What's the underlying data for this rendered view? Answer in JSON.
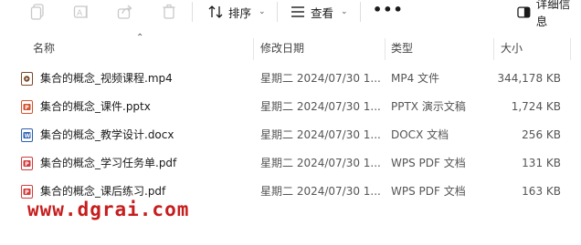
{
  "toolbar": {
    "sort_label": "排序",
    "view_label": "查看",
    "more_label": "•••",
    "details_label": "详细信息",
    "icons": [
      "copy-icon",
      "rename-icon",
      "share-icon",
      "delete-icon",
      "sort-icon",
      "view-icon",
      "details-pane-icon"
    ]
  },
  "columns": {
    "name": "名称",
    "modified": "修改日期",
    "type": "类型",
    "size": "大小"
  },
  "files": [
    {
      "name": "集合的概念_视频课程.mp4",
      "modified": "星期二 2024/07/30 1...",
      "type": "MP4 文件",
      "size": "344,178 KB",
      "icon": "mp4-file-icon",
      "icon_color": "#7a4a2a"
    },
    {
      "name": "集合的概念_课件.pptx",
      "modified": "星期二 2024/07/30 1...",
      "type": "PPTX 演示文稿",
      "size": "1,724 KB",
      "icon": "pptx-file-icon",
      "icon_color": "#d35230"
    },
    {
      "name": "集合的概念_教学设计.docx",
      "modified": "星期二 2024/07/30 1...",
      "type": "DOCX 文档",
      "size": "256 KB",
      "icon": "docx-file-icon",
      "icon_color": "#2b5fb4"
    },
    {
      "name": "集合的概念_学习任务单.pdf",
      "modified": "星期二 2024/07/30 1...",
      "type": "WPS PDF 文档",
      "size": "131 KB",
      "icon": "pdf-file-icon",
      "icon_color": "#d23c3c"
    },
    {
      "name": "集合的概念_课后练习.pdf",
      "modified": "星期二 2024/07/30 1...",
      "type": "WPS PDF 文档",
      "size": "163 KB",
      "icon": "pdf-file-icon",
      "icon_color": "#d23c3c"
    }
  ],
  "watermark": "www.dgrai.com"
}
